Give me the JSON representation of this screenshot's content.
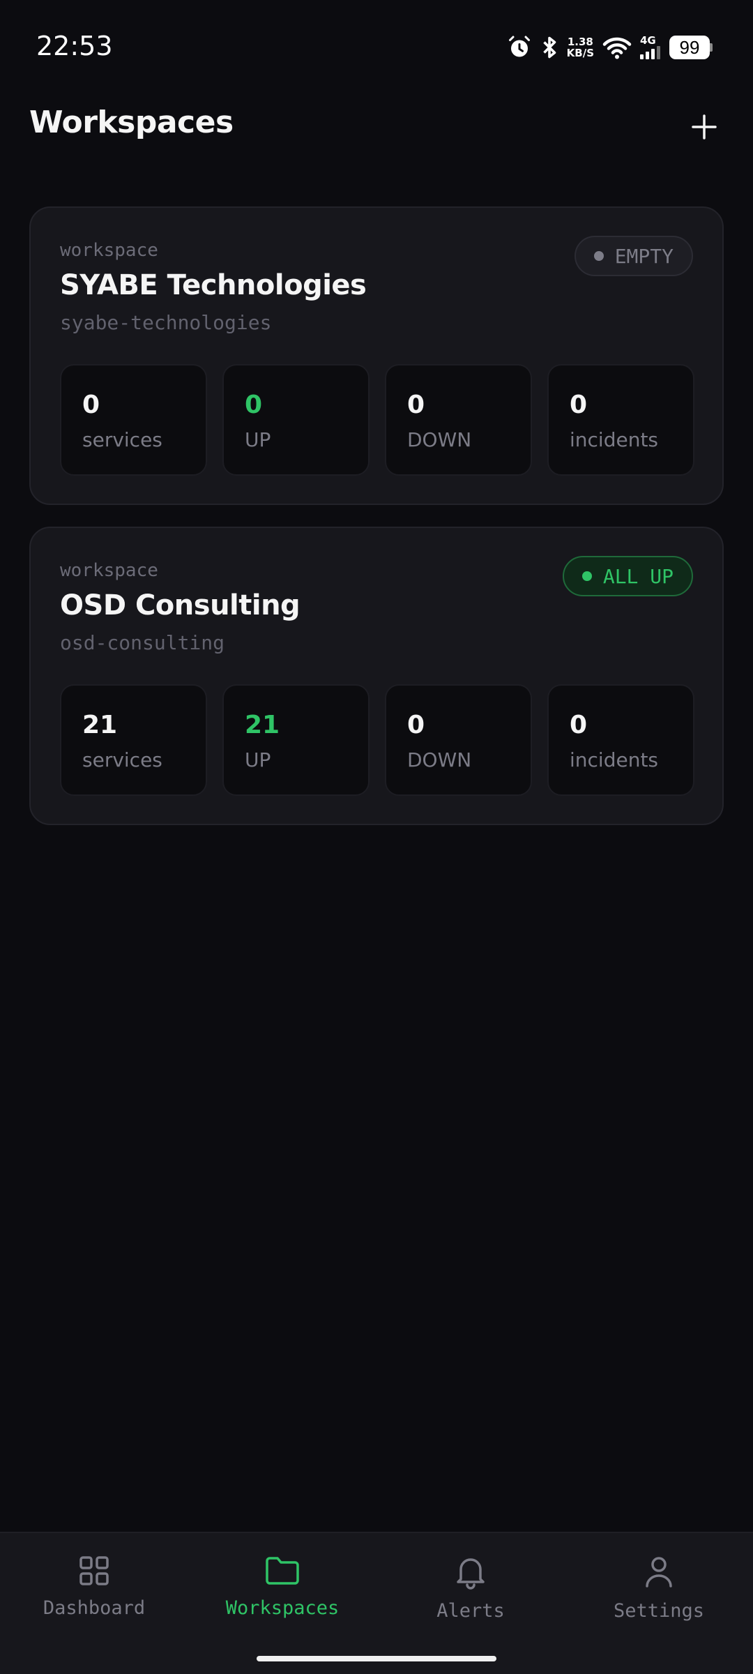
{
  "status_bar": {
    "time": "22:53",
    "speed_value": "1.38",
    "speed_unit": "KB/S",
    "network": "4G",
    "battery": "99"
  },
  "header": {
    "title": "Workspaces",
    "add_icon": "plus-icon"
  },
  "workspaces": [
    {
      "kicker": "workspace",
      "name": "SYABE Technologies",
      "slug": "syabe-technologies",
      "badge": "EMPTY",
      "stats": {
        "services": {
          "value": "0",
          "label": "services"
        },
        "up": {
          "value": "0",
          "label": "UP"
        },
        "down": {
          "value": "0",
          "label": "DOWN"
        },
        "incidents": {
          "value": "0",
          "label": "incidents"
        }
      }
    },
    {
      "kicker": "workspace",
      "name": "OSD Consulting",
      "slug": "osd-consulting",
      "badge": "ALL UP",
      "stats": {
        "services": {
          "value": "21",
          "label": "services"
        },
        "up": {
          "value": "21",
          "label": "UP"
        },
        "down": {
          "value": "0",
          "label": "DOWN"
        },
        "incidents": {
          "value": "0",
          "label": "incidents"
        }
      }
    }
  ],
  "nav": {
    "items": [
      {
        "label": "Dashboard",
        "icon": "grid-icon"
      },
      {
        "label": "Workspaces",
        "icon": "folder-icon",
        "active": true
      },
      {
        "label": "Alerts",
        "icon": "bell-icon"
      },
      {
        "label": "Settings",
        "icon": "user-icon"
      }
    ]
  },
  "colors": {
    "background": "#0c0c10",
    "card": "#17171c",
    "accent_green": "#2fc466",
    "muted_text": "#7c7c87"
  }
}
